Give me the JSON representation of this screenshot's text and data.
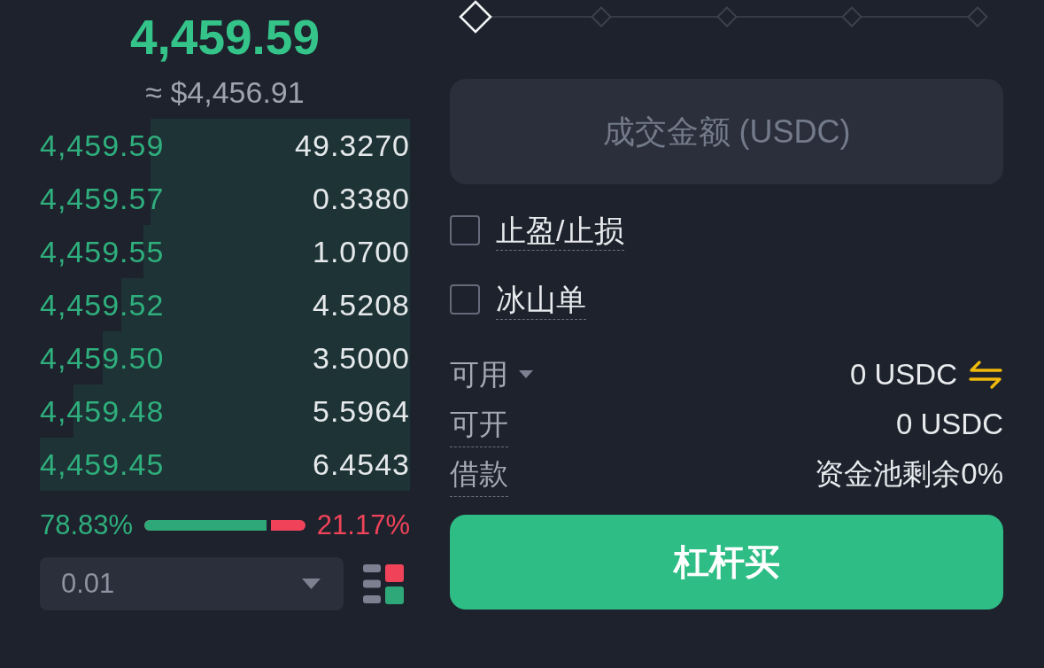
{
  "ticker": {
    "price": "4,459.59",
    "approx": "≈ $4,456.91"
  },
  "order_book": {
    "rows": [
      {
        "price": "4,459.59",
        "amount": "49.3270",
        "level": 0.7
      },
      {
        "price": "4,459.57",
        "amount": "0.3380",
        "level": 0.7
      },
      {
        "price": "4,459.55",
        "amount": "1.0700",
        "level": 0.72
      },
      {
        "price": "4,459.52",
        "amount": "4.5208",
        "level": 0.78
      },
      {
        "price": "4,459.50",
        "amount": "3.5000",
        "level": 0.83
      },
      {
        "price": "4,459.48",
        "amount": "5.5964",
        "level": 0.91
      },
      {
        "price": "4,459.45",
        "amount": "6.4543",
        "level": 1
      }
    ]
  },
  "ratio": {
    "buy": "78.83%",
    "sell": "21.17%",
    "level": 0.7883
  },
  "precision": {
    "value": "0.01"
  },
  "leverage_slider": {
    "level": 0
  },
  "amount_field": {
    "placeholder": "成交金额 (USDC)"
  },
  "options": [
    {
      "label": "止盈/止损",
      "checked": false
    },
    {
      "label": "冰山单",
      "checked": false
    }
  ],
  "balances": [
    {
      "kind": "dropdown",
      "label": "可用",
      "value": "0 USDC"
    },
    {
      "kind": "hint",
      "label": "可开",
      "value": "0 USDC"
    },
    {
      "kind": "hint",
      "label": "借款",
      "value": "资金池剩余0%"
    }
  ],
  "buy_button": {
    "label": "杠杆买"
  }
}
